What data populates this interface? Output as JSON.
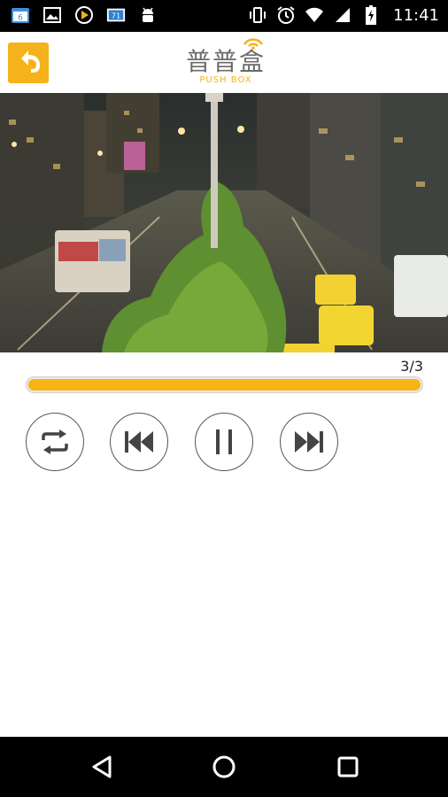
{
  "status_bar": {
    "time": "11:41",
    "left_icons": [
      "calendar-icon",
      "gallery-icon",
      "play-store-icon",
      "weather-icon",
      "android-debug-icon"
    ],
    "calendar_day": "6",
    "weather_temp": "71",
    "right_icons": [
      "vibrate-icon",
      "alarm-icon",
      "wifi-icon",
      "signal-icon",
      "battery-icon"
    ]
  },
  "header": {
    "logo_title": "普普盒",
    "logo_subtitle": "PUSH BOX",
    "accent_color": "#f6b21a"
  },
  "player": {
    "track_counter": "3/3",
    "progress": 1.0,
    "controls": [
      "repeat-icon",
      "previous-icon",
      "pause-icon",
      "next-icon"
    ]
  },
  "nav_bar": {
    "buttons": [
      "back-icon",
      "home-icon",
      "recents-icon"
    ]
  }
}
